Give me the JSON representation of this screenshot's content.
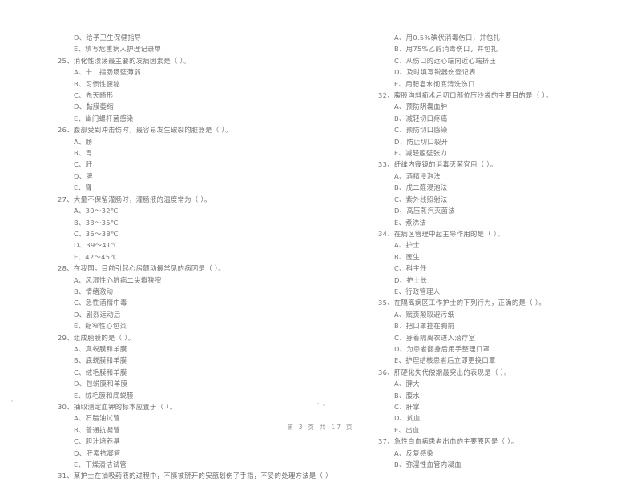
{
  "document": {
    "footer": "第 3 页 共 17 页"
  },
  "left_column": {
    "orphan_options": [
      "D、给予卫生保健指导",
      "E、填写危重病人护理记录单"
    ],
    "questions": [
      {
        "number": "25",
        "stem": "25、消化性溃疡最主要的发病因素是（    ）。",
        "options": [
          "A、十二指肠肠壁薄弱",
          "B、习惯性便秘",
          "C、先天畸形",
          "D、黏膜萎缩",
          "E、幽门螺杆菌感染"
        ]
      },
      {
        "number": "26",
        "stem": "26、腹部受到冲击伤时，最容易发生破裂的脏器是（    ）。",
        "options": [
          "A、肠",
          "B、胃",
          "C、肝",
          "D、脾",
          "E、肾"
        ]
      },
      {
        "number": "27",
        "stem": "27、大量不保留灌肠时，灌肠液的温度常为（    ）。",
        "options": [
          "A、30～32℃",
          "B、33～35℃",
          "C、36～38℃",
          "D、39～41℃",
          "E、42～45℃"
        ]
      },
      {
        "number": "28",
        "stem": "28、在我国，目前引起心房颤动最常见的病因是（    ）。",
        "options": [
          "A、风湿性心脏病二尖瓣狭窄",
          "B、情绪激动",
          "C、急性酒精中毒",
          "D、剧烈运动后",
          "E、缩窄性心包炎"
        ]
      },
      {
        "number": "29",
        "stem": "29、组成胎膜的是（    ）。",
        "options": [
          "A、真蜕膜和羊膜",
          "B、底蜕膜和羊膜",
          "C、绒毛膜和羊膜",
          "D、包蜕膜和羊膜",
          "E、绒毛膜和底蜕膜"
        ]
      },
      {
        "number": "30",
        "stem": "30、抽取测定血钾的标本应置于（    ）。",
        "options": [
          "A、石腊油试管",
          "B、普通抗凝管",
          "C、胆汁培养基",
          "D、肝素抗凝管",
          "E、干燥清洁试管"
        ]
      },
      {
        "number": "31",
        "stem": "31、某护士在抽吸药液的过程中，不慎被掰开的安瓿划伤了手指，不妥的处理方法是（    ）",
        "options": []
      }
    ]
  },
  "right_column": {
    "orphan_options": [
      "A、用0.5%碘伏消毒伤口，并包扎",
      "B、用75%乙醇消毒伤口，并包扎",
      "C、从伤口的远心端向近心端挤压",
      "D、及时填写锐器伤登记表",
      "E、用肥皂水彻底清洗伤口"
    ],
    "questions": [
      {
        "number": "32",
        "stem": "32、腹股沟斜疝术后切口部位压沙袋的主要目的是（    ）。",
        "options": [
          "A、预防阴囊血肿",
          "B、减轻切口疼痛",
          "C、预防切口感染",
          "D、防止切口裂开",
          "E、减轻腹壁张力"
        ]
      },
      {
        "number": "33",
        "stem": "33、纤维内窥镜的消毒灭菌宜用（    ）。",
        "options": [
          "A、酒精浸泡法",
          "B、戊二醛浸泡法",
          "C、紫外线照射法",
          "D、高压蒸汽灭菌法",
          "E、煮沸法"
        ]
      },
      {
        "number": "34",
        "stem": "34、在病区管理中起主导作用的是（    ）。",
        "options": [
          "A、护士",
          "B、医生",
          "C、科主任",
          "D、护士长",
          "E、行政管理人"
        ]
      },
      {
        "number": "35",
        "stem": "35、在隔离病区工作护士的下列行为，正确的是（    ）。",
        "options": [
          "A、赋页颠取避污纸",
          "B、把口罩挂在胸前",
          "C、身着隔离衣进入治疗室",
          "D、为患者翻身后用手整理口罩",
          "E、护理结核患者后立即更换口罩"
        ]
      },
      {
        "number": "36",
        "stem": "36、肝硬化失代偿期最突出的表现是（    ）。",
        "options": [
          "A、脾大",
          "B、腹水",
          "C、肝掌",
          "D、贫血",
          "E、出血"
        ]
      },
      {
        "number": "37",
        "stem": "37、急性白血病患者出血的主要原因是（    ）。",
        "options": [
          "A、反复感染",
          "B、弥漫性血管内凝血"
        ]
      }
    ]
  }
}
